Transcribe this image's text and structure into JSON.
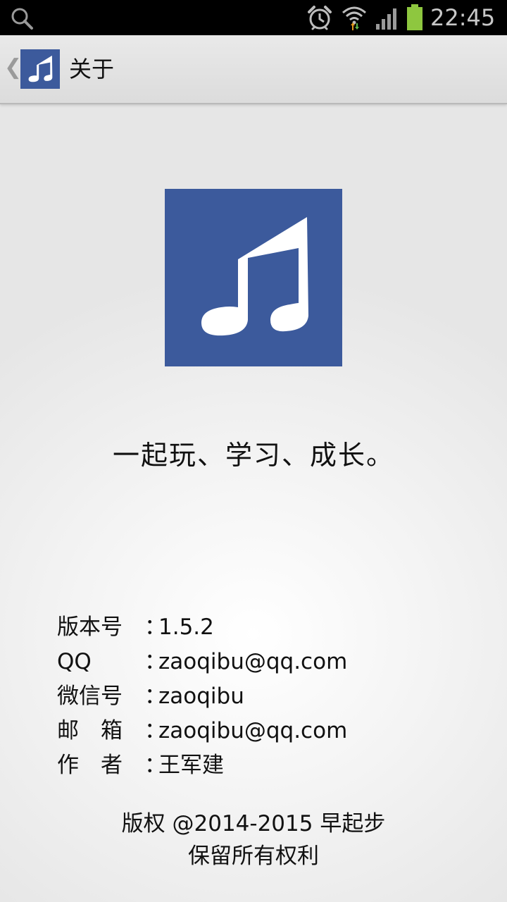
{
  "status_bar": {
    "time": "22:45",
    "icons": [
      "search-icon",
      "alarm-icon",
      "wifi-icon",
      "signal-icon",
      "battery-icon"
    ],
    "battery_color": "#8ec73f"
  },
  "action_bar": {
    "back_glyph": "❮",
    "title": "关于",
    "app_icon": "music-note-icon"
  },
  "colors": {
    "brand": "#3c5a9c"
  },
  "main": {
    "logo_icon": "music-note-icon",
    "slogan": "一起玩、学习、成长。",
    "info": [
      {
        "label": "版本号",
        "sep": "：",
        "value": "1.5.2"
      },
      {
        "label": "QQ",
        "sep": "：",
        "value": "zaoqibu@qq.com"
      },
      {
        "label": "微信号",
        "sep": "：",
        "value": "zaoqibu"
      },
      {
        "label": "邮　箱",
        "sep": "：",
        "value": "zaoqibu@qq.com"
      },
      {
        "label": "作　者",
        "sep": "：",
        "value": "王军建"
      }
    ],
    "copyright_line1": "版权 @2014-2015 早起步",
    "copyright_line2": "保留所有权利"
  }
}
